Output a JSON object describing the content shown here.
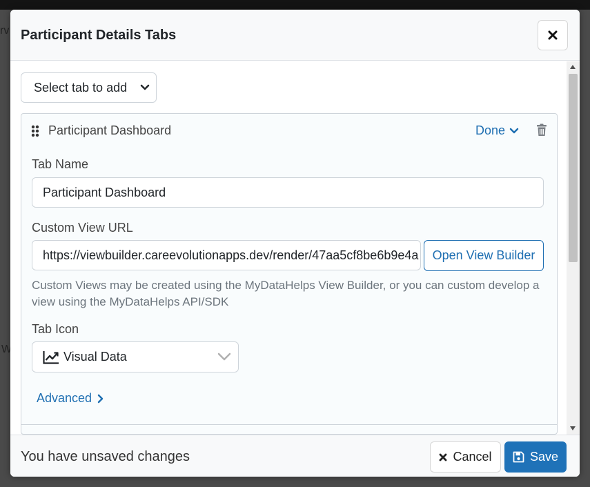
{
  "background": {
    "fragment_top": "rv",
    "fragment_mid": "W"
  },
  "modal": {
    "title": "Participant Details Tabs",
    "close_icon": "close-icon"
  },
  "toolbar": {
    "select_tab_label": "Select tab to add"
  },
  "card": {
    "title": "Participant Dashboard",
    "done_label": "Done",
    "tab_name_label": "Tab Name",
    "tab_name_value": "Participant Dashboard",
    "custom_view_url_label": "Custom View URL",
    "custom_view_url_value": "https://viewbuilder.careevolutionapps.dev/render/47aa5cf8be6b9e4a",
    "open_view_builder_label": "Open View Builder",
    "help_text": "Custom Views may be created using the MyDataHelps View Builder, or you can custom develop a view using the MyDataHelps API/SDK",
    "tab_icon_label": "Tab Icon",
    "tab_icon_value": "Visual Data",
    "advanced_label": "Advanced"
  },
  "footer": {
    "unsaved_text": "You have unsaved changes",
    "cancel_label": "Cancel",
    "save_label": "Save"
  },
  "colors": {
    "primary": "#1f72b8",
    "link": "#1f6fb2",
    "border": "#ced4da"
  }
}
